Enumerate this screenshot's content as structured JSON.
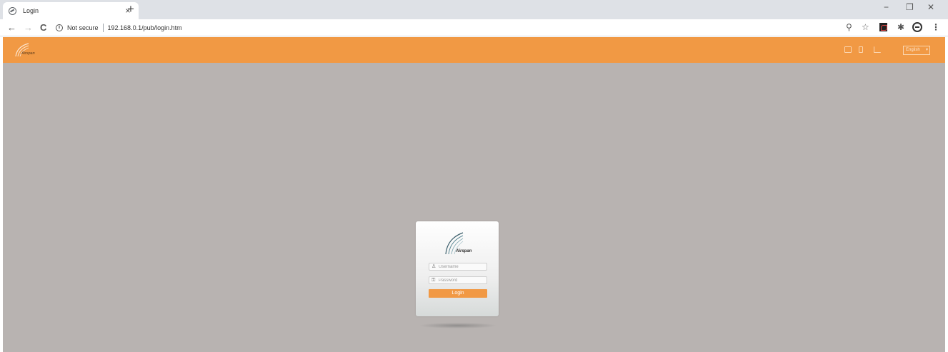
{
  "browser": {
    "tab_title": "Login",
    "tab_close": "×",
    "new_tab": "+",
    "window_controls": {
      "minimize": "−",
      "restore": "❐",
      "close": "✕"
    },
    "nav": {
      "back": "←",
      "forward": "→",
      "reload": "C"
    },
    "security_label": "Not secure",
    "url": "192.168.0.1/pub/login.htm",
    "toolbar_icons": [
      "zoom-icon",
      "star-icon",
      "pdf-extension-icon",
      "extensions-icon",
      "profile-icon",
      "menu-icon"
    ],
    "zoom_glyph": "⚲",
    "star_glyph": "☆",
    "puzzle_glyph": "✱",
    "menu_glyph": "⋮"
  },
  "header": {
    "brand": "Airspan",
    "language": "English",
    "icons": [
      "screen-icon",
      "antenna-icon",
      "signal-icon"
    ],
    "bar_color": "#f19944"
  },
  "login": {
    "brand": "Airspan",
    "username_placeholder": "Username",
    "password_placeholder": "Password",
    "button_label": "Login",
    "user_glyph": "♙",
    "lock_glyph": "⚿"
  },
  "colors": {
    "accent": "#f19944",
    "background": "#b8b3b1"
  }
}
